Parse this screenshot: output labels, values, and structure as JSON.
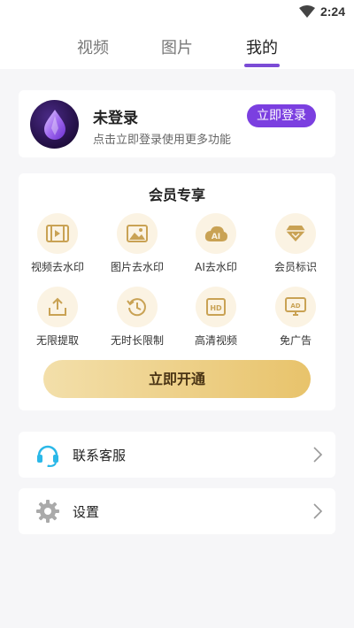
{
  "status_bar": {
    "time": "2:24"
  },
  "tabs": [
    {
      "label": "视频"
    },
    {
      "label": "图片"
    },
    {
      "label": "我的",
      "active": true
    }
  ],
  "login": {
    "title": "未登录",
    "subtitle": "点击立即登录使用更多功能",
    "button": "立即登录"
  },
  "vip": {
    "title": "会员专享",
    "features": [
      {
        "label": "视频去水印",
        "icon": "video-watermark-icon"
      },
      {
        "label": "图片去水印",
        "icon": "image-watermark-icon"
      },
      {
        "label": "AI去水印",
        "icon": "ai-icon"
      },
      {
        "label": "会员标识",
        "icon": "diamond-icon"
      },
      {
        "label": "无限提取",
        "icon": "download-tray-icon"
      },
      {
        "label": "无时长限制",
        "icon": "history-clock-icon"
      },
      {
        "label": "高清视频",
        "icon": "hd-icon"
      },
      {
        "label": "免广告",
        "icon": "ad-free-icon"
      }
    ],
    "button": "立即开通"
  },
  "menu": {
    "contact": "联系客服",
    "settings": "设置"
  },
  "colors": {
    "accent": "#7b3fe0",
    "tab_indicator": "#7b4bd6",
    "gold_light": "#f3dfaa",
    "gold_dark": "#e8c36b",
    "feature_bg": "#fbf3e3",
    "feature_icon": "#c9a254",
    "headset_icon": "#2bb8e8"
  }
}
